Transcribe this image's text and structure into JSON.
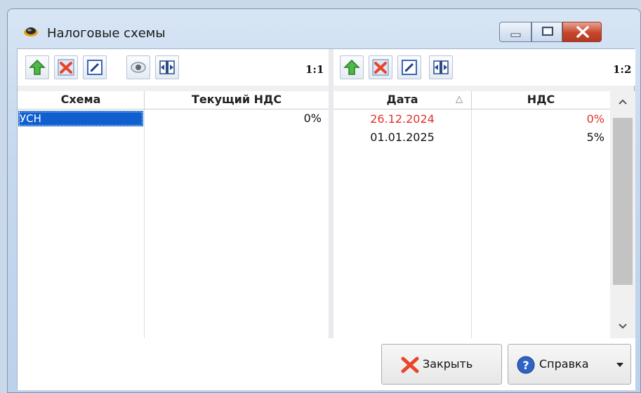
{
  "window": {
    "title": "Налоговые схемы"
  },
  "left_panel": {
    "ratio_label": "1:1",
    "columns": [
      "Схема",
      "Текущий НДС"
    ],
    "rows": [
      {
        "scheme": "УСН",
        "vat": "0%"
      }
    ]
  },
  "right_panel": {
    "ratio_label": "1:2",
    "columns": [
      "Дата",
      "НДС"
    ],
    "sort_indicator": "△",
    "rows": [
      {
        "date": "26.12.2024",
        "vat": "0%",
        "color": "#e0322a"
      },
      {
        "date": "01.01.2025",
        "vat": "5%",
        "color": "#111111"
      }
    ]
  },
  "buttons": {
    "close_label": "Закрыть",
    "help_label": "Справка"
  },
  "colors": {
    "selection": "#0f5fcf",
    "accent_red": "#e0322a"
  }
}
